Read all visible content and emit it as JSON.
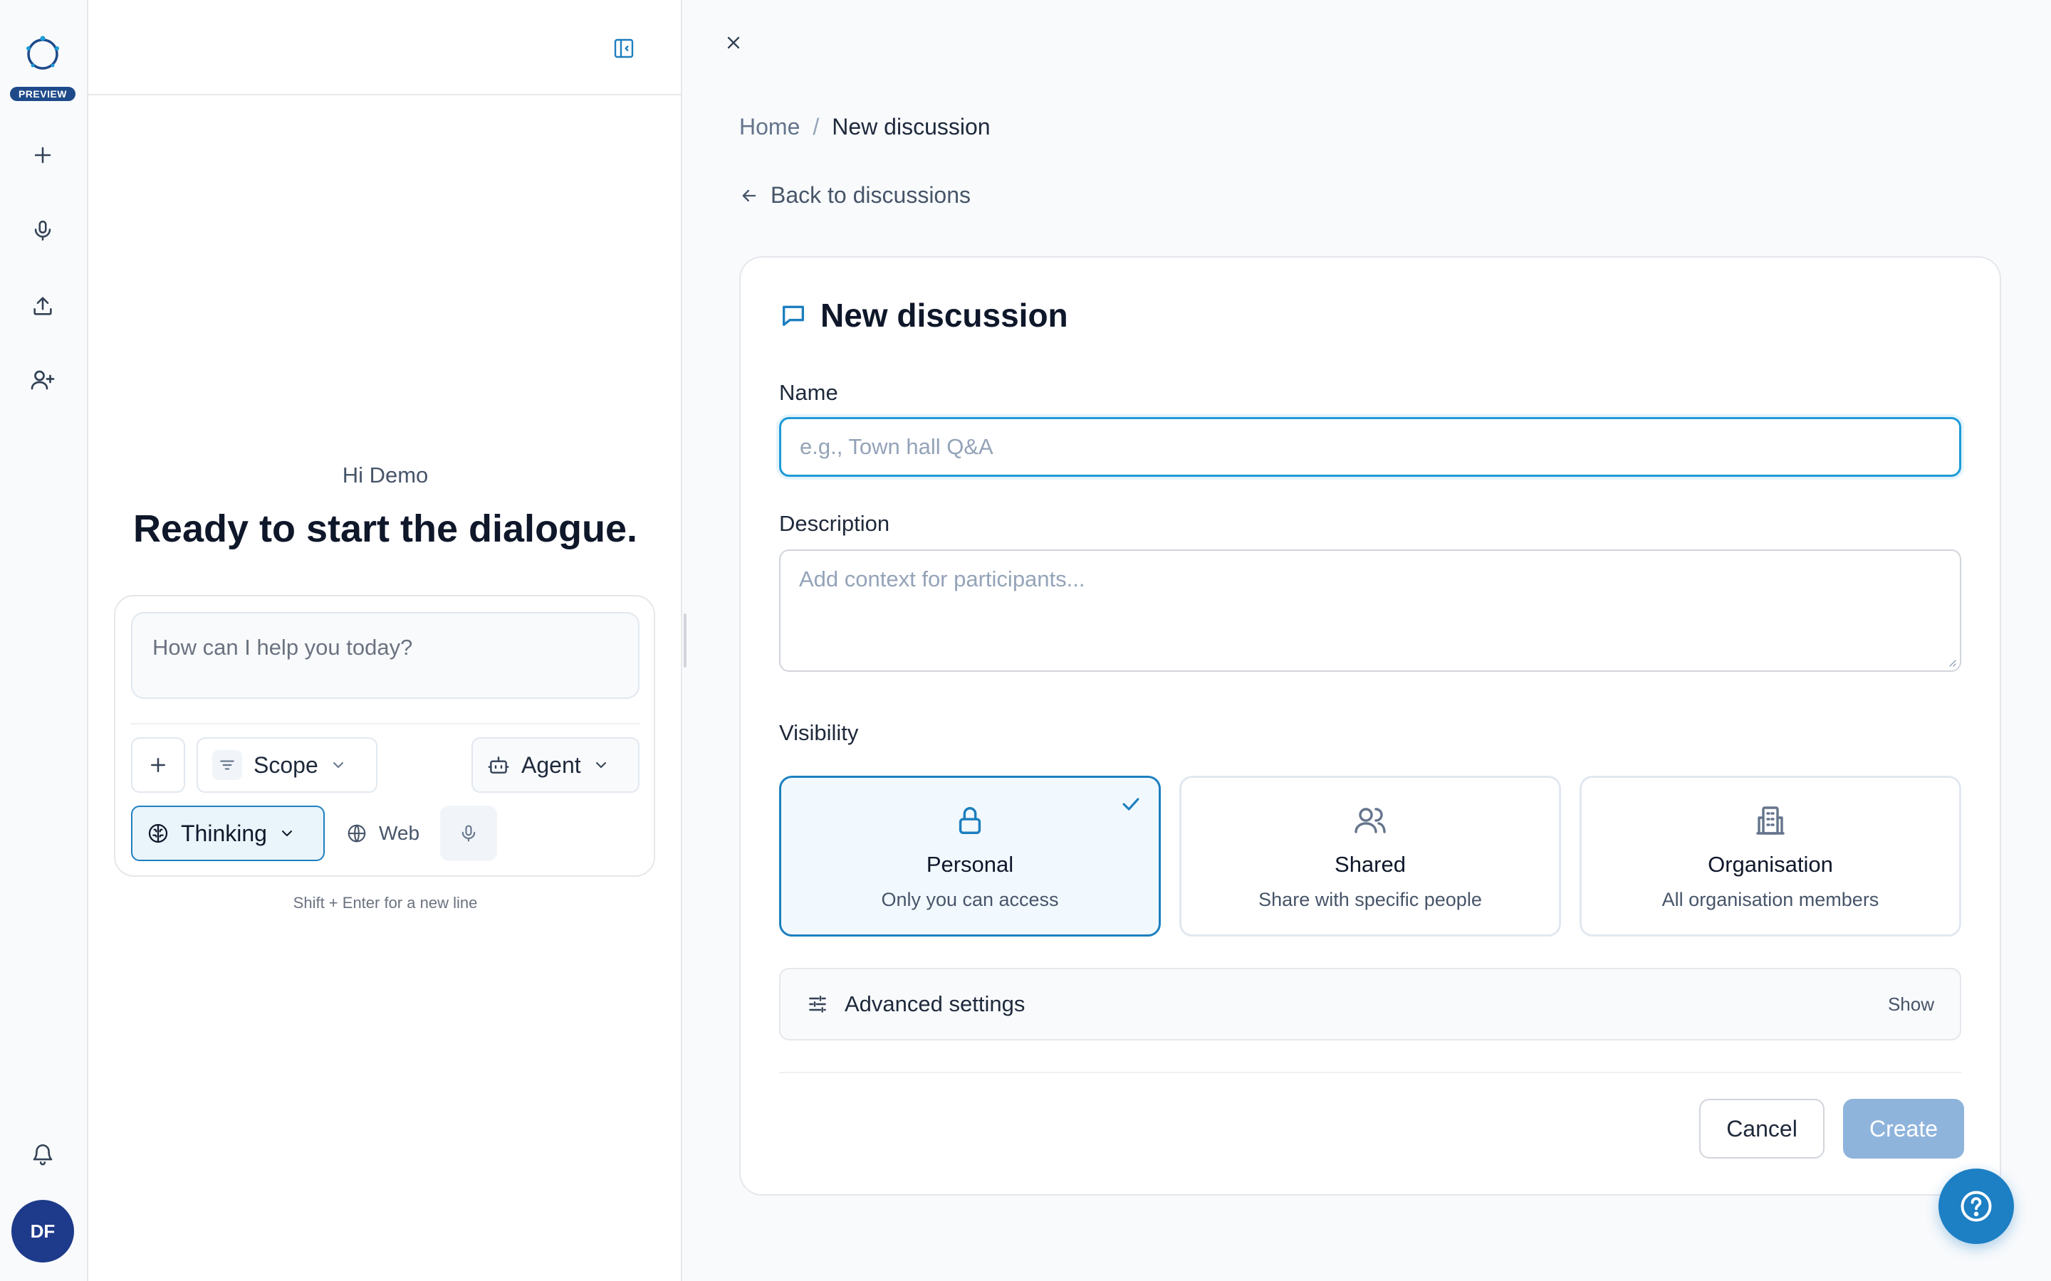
{
  "rail": {
    "badge": "PREVIEW",
    "actions": [
      "plus-icon",
      "microphone-icon",
      "upload-icon",
      "user-plus-icon"
    ],
    "bottom": [
      "bell-icon"
    ],
    "avatar_initials": "DF"
  },
  "chat": {
    "greeting": "Hi Demo",
    "headline": "Ready to start the dialogue.",
    "prompt_placeholder": "How can I help you today?",
    "scope_label": "Scope",
    "agent_label": "Agent",
    "thinking_label": "Thinking",
    "web_label": "Web",
    "hint": "Shift + Enter for a new line"
  },
  "breadcrumb": {
    "home": "Home",
    "separator": "/",
    "current": "New discussion"
  },
  "back_link": "Back to discussions",
  "form": {
    "title": "New discussion",
    "name_label": "Name",
    "name_placeholder": "e.g., Town hall Q&A",
    "description_label": "Description",
    "description_placeholder": "Add context for participants...",
    "visibility_label": "Visibility",
    "visibility_options": [
      {
        "title": "Personal",
        "desc": "Only you can access",
        "icon": "lock-icon",
        "selected": true
      },
      {
        "title": "Shared",
        "desc": "Share with specific people",
        "icon": "users-icon",
        "selected": false
      },
      {
        "title": "Organisation",
        "desc": "All organisation members",
        "icon": "building-icon",
        "selected": false
      }
    ],
    "advanced_label": "Advanced settings",
    "advanced_toggle": "Show",
    "cancel_label": "Cancel",
    "create_label": "Create"
  },
  "colors": {
    "accent": "#1d7fbf",
    "create_disabled": "#8fb4dc",
    "avatar": "#1e3a8a",
    "help_fab": "#1d7fc4"
  }
}
